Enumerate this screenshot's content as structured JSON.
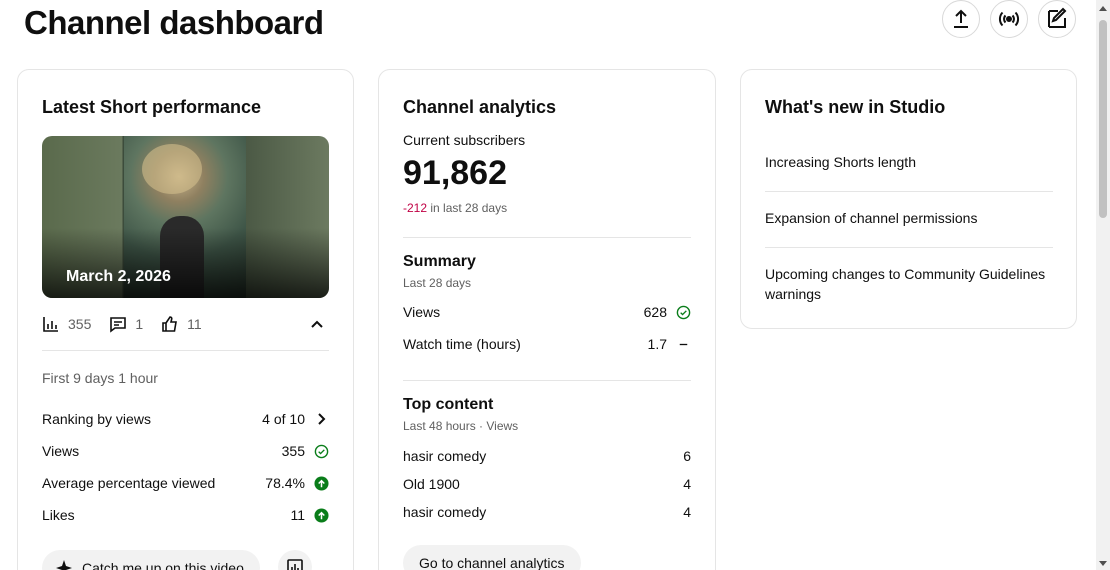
{
  "page": {
    "title": "Channel dashboard"
  },
  "top_actions": [
    {
      "name": "upload",
      "icon": "upload-icon"
    },
    {
      "name": "go-live",
      "icon": "broadcast-icon"
    },
    {
      "name": "create-post",
      "icon": "edit-icon"
    }
  ],
  "latest_short": {
    "title": "Latest Short performance",
    "thumbnail": {
      "date": "March 2, 2026"
    },
    "stats": {
      "views": "355",
      "comments": "1",
      "likes": "11"
    },
    "period": "First 9 days 1 hour",
    "metrics": [
      {
        "label": "Ranking by views",
        "value": "4 of 10",
        "icon": "chevron-right-icon"
      },
      {
        "label": "Views",
        "value": "355",
        "icon": "check-circle-icon"
      },
      {
        "label": "Average percentage viewed",
        "value": "78.4%",
        "icon": "arrow-up-circle-icon"
      },
      {
        "label": "Likes",
        "value": "11",
        "icon": "arrow-up-circle-icon"
      }
    ],
    "catch_up_label": "Catch me up on this video"
  },
  "channel_analytics": {
    "title": "Channel analytics",
    "subs_label": "Current subscribers",
    "subs_count": "91,862",
    "subs_change_value": "-212",
    "subs_change_text": "in last 28 days",
    "summary": {
      "title": "Summary",
      "subtitle": "Last 28 days",
      "rows": [
        {
          "label": "Views",
          "value": "628",
          "icon": "check-circle-icon"
        },
        {
          "label": "Watch time (hours)",
          "value": "1.7",
          "icon": "dash-icon"
        }
      ]
    },
    "top_content": {
      "title": "Top content",
      "subtitle": "Last 48 hours · Views",
      "rows": [
        {
          "label": "hasir comedy",
          "value": "6"
        },
        {
          "label": "Old 1900",
          "value": "4"
        },
        {
          "label": "hasir comedy",
          "value": "4"
        }
      ]
    },
    "go_label": "Go to channel analytics"
  },
  "whats_new": {
    "title": "What's new in Studio",
    "items": [
      "Increasing Shorts length",
      "Expansion of channel permissions",
      "Upcoming changes to Community Guidelines warnings"
    ]
  },
  "colors": {
    "positive": "#0a7d1a",
    "negative": "#c00044",
    "secondary_text": "#606060"
  }
}
